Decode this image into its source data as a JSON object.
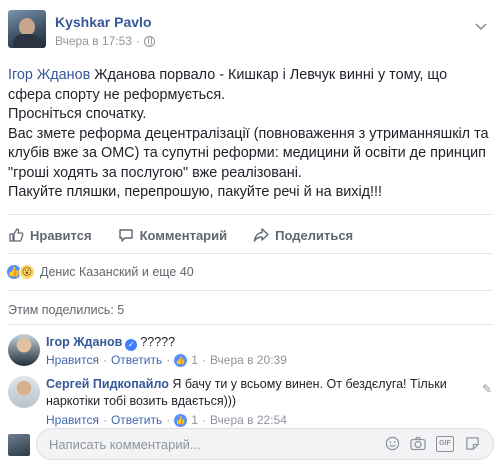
{
  "post": {
    "author": "Kyshkar Pavlo",
    "timestamp": "Вчера в 17:53",
    "text": {
      "mention": "Ігор Жданов",
      "line1_rest": " Жданова порвало - Кишкар і Левчук винні у тому, що",
      "line2": "сфера спорту не реформується.",
      "line3": "Просніться спочатку.",
      "line4": "Вас змете реформа децентралізації (повноваження з утриманняшкіл та",
      "line5": "клубів вже за ОМС) та супутні реформи: медицини й освіти де принцип",
      "line6": "\"гроші ходять за послугою\" вже реалізовані.",
      "line7": "Пакуйте пляшки, перепрошую, пакуйте речі й на вихід!!!"
    }
  },
  "actions": {
    "like": "Нравится",
    "comment": "Комментарий",
    "share": "Поделиться"
  },
  "reactions": {
    "text": "Денис Казанский и еще 40"
  },
  "shared": "Этим поделились: 5",
  "comments": [
    {
      "author": "Ігор Жданов",
      "text": "?????",
      "like": "Нравится",
      "sep1": "·",
      "reply": "Ответить",
      "sep2": "·",
      "likes": "1",
      "sep3": "·",
      "time": "Вчера в 20:39"
    },
    {
      "author": "Сергей Пидкопайло",
      "text_line1": "Я бачу ти у всьому винен. От бездєлуга! Тільки",
      "text_line2": "наркотіки тобі возить вдається)))",
      "like": "Нравится",
      "sep1": "·",
      "reply": "Ответить",
      "sep2": "·",
      "likes": "1",
      "sep3": "·",
      "time": "Вчера в 22:54"
    }
  ],
  "composer": {
    "placeholder": "Написать комментарий..."
  },
  "icons": {
    "globe": "globe-icon",
    "chevron": "chevron-down-icon",
    "like": "thumbs-up-icon",
    "comment": "speech-bubble-icon",
    "share": "share-arrow-icon",
    "emoji": "smiley-icon",
    "camera": "camera-icon",
    "gif": "gif-icon",
    "sticker": "sticker-icon"
  },
  "colors": {
    "link": "#365899",
    "muted": "#90949c",
    "action": "#606770",
    "like_blue": "#5890ff"
  }
}
